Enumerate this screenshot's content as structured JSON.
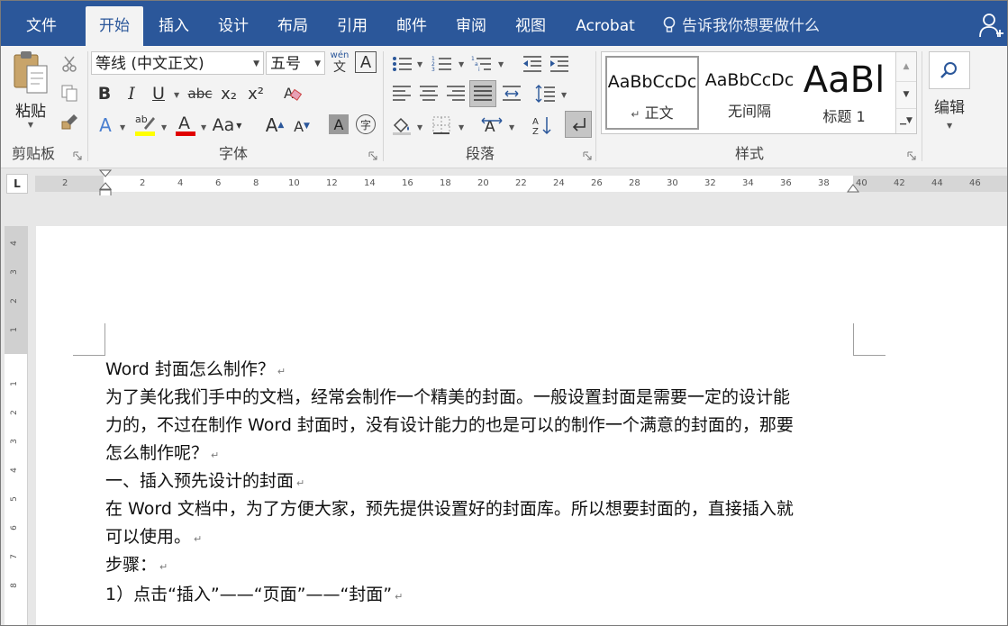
{
  "tabs": [
    "文件",
    "开始",
    "插入",
    "设计",
    "布局",
    "引用",
    "邮件",
    "审阅",
    "视图",
    "Acrobat"
  ],
  "active_tab": "开始",
  "tell_me": "告诉我你想要做什么",
  "clipboard": {
    "paste_label": "粘贴",
    "group_label": "剪贴板"
  },
  "font": {
    "name": "等线 (中文正文)",
    "size": "五号",
    "group_label": "字体",
    "bold": "B",
    "italic": "I",
    "underline": "U",
    "strike": "abc",
    "sub": "x₂",
    "sup": "x²",
    "font_color_letter": "A",
    "change_case": "Aa",
    "grow": "A",
    "shrink": "A",
    "char_shade": "A",
    "enclose": "字",
    "phonetic_top": "wén",
    "phonetic_bottom": "文",
    "border_letter": "A",
    "highlight_color": "#ffff00",
    "font_color": "#e00000"
  },
  "paragraph": {
    "group_label": "段落"
  },
  "styles": {
    "group_label": "样式",
    "items": [
      {
        "preview": "AaBbCcDc",
        "name": "正文",
        "marker": "↵"
      },
      {
        "preview": "AaBbCcDc",
        "name": "无间隔"
      },
      {
        "preview": "AaBl",
        "name": "标题 1"
      }
    ]
  },
  "editing": {
    "label": "编辑"
  },
  "ruler": {
    "tab_selector": "L",
    "left_marks": [
      "2"
    ],
    "marks": [
      "2",
      "4",
      "6",
      "8",
      "10",
      "12",
      "14",
      "16",
      "18",
      "20",
      "22",
      "24",
      "26",
      "28",
      "30",
      "32",
      "34",
      "36",
      "38",
      "40",
      "42",
      "44",
      "46"
    ],
    "vertical_marks_top": [
      "4",
      "3",
      "2",
      "1"
    ],
    "vertical_marks_bottom": [
      "1",
      "1",
      "2",
      "3",
      "4",
      "5",
      "6",
      "7",
      "8"
    ]
  },
  "document": {
    "paragraph_mark": "↵",
    "paragraphs": [
      {
        "lines": [
          "Word 封面怎么制作？"
        ]
      },
      {
        "lines": [
          "为了美化我们手中的文档，经常会制作一个精美的封面。一般设置封面是需要一定的设计能",
          "力的，不过在制作 Word 封面时，没有设计能力的也是可以的制作一个满意的封面的，那要",
          "怎么制作呢？"
        ]
      },
      {
        "lines": [
          "一、插入预先设计的封面"
        ]
      },
      {
        "lines": [
          "在 Word 文档中，为了方便大家，预先提供设置好的封面库。所以想要封面的，直接插入就",
          "可以使用。"
        ]
      },
      {
        "lines": [
          "步骤："
        ]
      },
      {
        "lines": [
          "1）点击“插入”——“页面”——“封面”"
        ]
      }
    ]
  },
  "colors": {
    "tab_bar": "#2b579a",
    "ribbon": "#f3f3f3",
    "workspace": "#e7e7e7"
  }
}
